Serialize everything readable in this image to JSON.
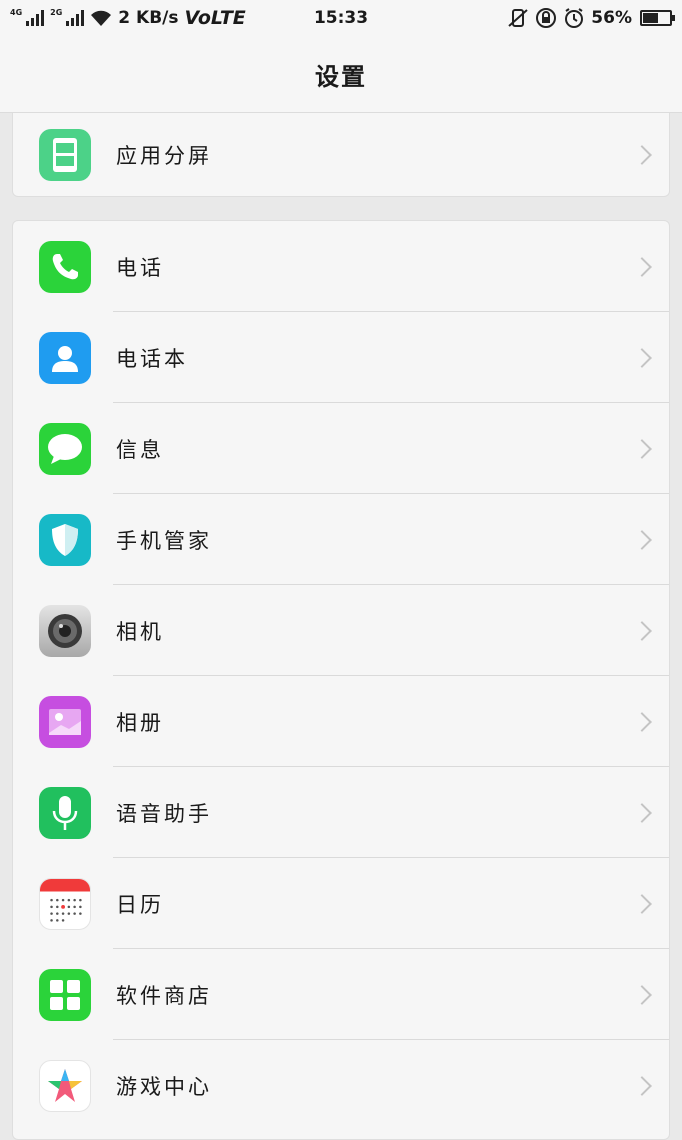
{
  "status_bar": {
    "sim1_label": "4G",
    "sim2_label": "2G",
    "net_speed": "2 KB/s",
    "volte": "VoLTE",
    "time": "15:33",
    "battery_text": "56%",
    "battery_level": 0.56
  },
  "header": {
    "title": "设置"
  },
  "group1": {
    "items": [
      {
        "label": "应用分屏",
        "icon": "split-screen-icon",
        "color": "#4cd288"
      }
    ]
  },
  "group2": {
    "items": [
      {
        "label": "电话",
        "icon": "phone-icon",
        "color": "#2bd33a"
      },
      {
        "label": "电话本",
        "icon": "contacts-icon",
        "color": "#1f9cf0"
      },
      {
        "label": "信息",
        "icon": "message-icon",
        "color": "#2bd33a"
      },
      {
        "label": "手机管家",
        "icon": "shield-icon",
        "color": "#17b9c7"
      },
      {
        "label": "相机",
        "icon": "camera-icon",
        "color": "#8e8e8e"
      },
      {
        "label": "相册",
        "icon": "gallery-icon",
        "color": "#c64ee0"
      },
      {
        "label": "语音助手",
        "icon": "microphone-icon",
        "color": "#21c05e"
      },
      {
        "label": "日历",
        "icon": "calendar-icon",
        "color": "#ffffff"
      },
      {
        "label": "软件商店",
        "icon": "app-store-icon",
        "color": "#2bd33a"
      },
      {
        "label": "游戏中心",
        "icon": "game-center-icon",
        "color": "#ffffff"
      }
    ]
  }
}
